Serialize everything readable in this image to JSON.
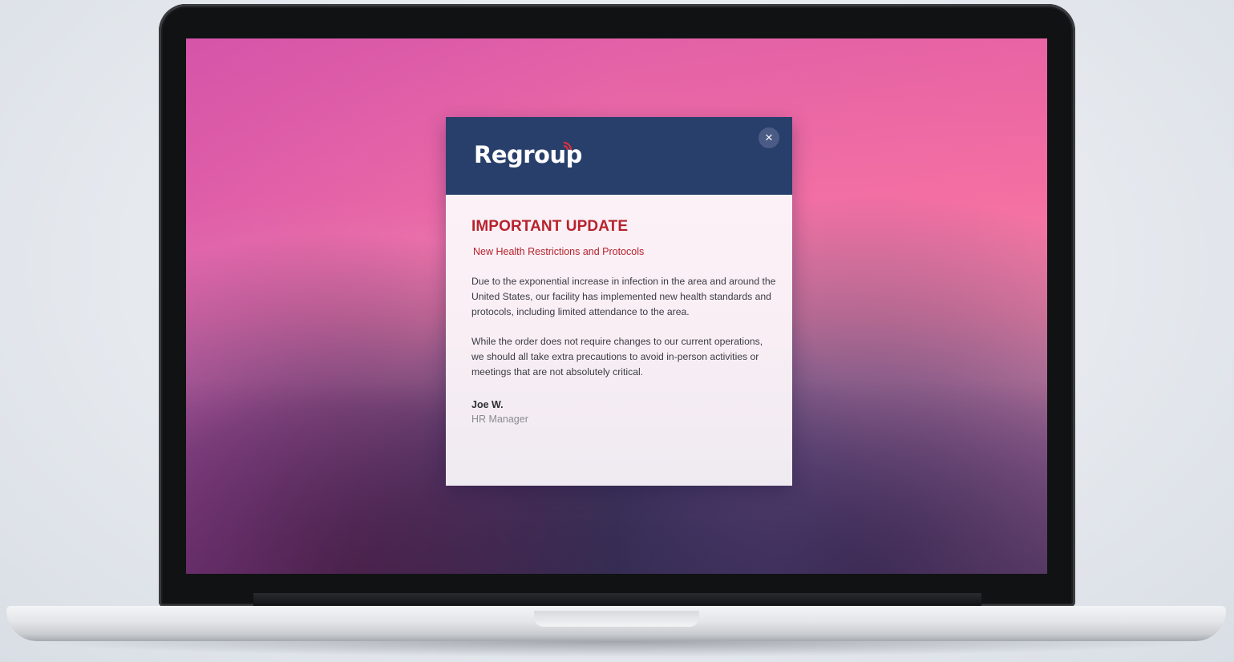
{
  "dialog": {
    "brand": "Regroup",
    "close_label": "×",
    "title": "IMPORTANT UPDATE",
    "subtitle": "New Health Restrictions and Protocols",
    "paragraphs": [
      "Due to the exponential increase in infection in the area and around the United States, our facility has implemented new health standards and protocols, including limited attendance to the area.",
      "While the order does not require changes to our current operations, we should all take extra precautions to avoid in-person activities or meetings that are not absolutely critical."
    ],
    "signer_name": "Joe W.",
    "signer_title": "HR Manager"
  },
  "icons": {
    "close": "close-icon",
    "logo_signal": "signal-waves-icon"
  },
  "colors": {
    "header": "#283f6b",
    "accent_red": "#b7222d",
    "close_button": "#4a5c86"
  }
}
